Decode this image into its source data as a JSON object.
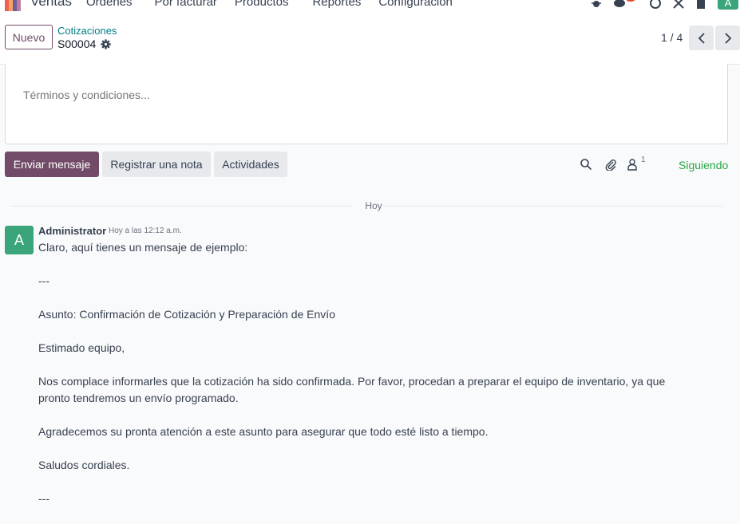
{
  "navbar": {
    "app_name": "Ventas",
    "menu": [
      "Órdenes",
      "Por facturar",
      "Productos",
      "Reportes",
      "Configuración"
    ],
    "user_initial": "A",
    "brand_colors": [
      "#f06050",
      "#f4a460",
      "#6e5e9e",
      "#c27ba0"
    ]
  },
  "control_panel": {
    "new_button": "Nuevo",
    "breadcrumb": "Cotizaciones",
    "record_name": "S00004",
    "pager": "1 / 4"
  },
  "form": {
    "terms_placeholder": "Términos y condiciones..."
  },
  "chatter": {
    "send_message": "Enviar mensaje",
    "log_note": "Registrar una nota",
    "activities": "Actividades",
    "followers_count": "1",
    "following": "Siguiendo",
    "date_separator": "Hoy",
    "message": {
      "avatar_initial": "A",
      "author": "Administrator",
      "date": "Hoy a las 12:12 a.m.",
      "paragraphs": [
        "Claro, aquí tienes un mensaje de ejemplo:",
        "---",
        "Asunto: Confirmación de Cotización y Preparación de Envío",
        "Estimado equipo,",
        "Nos complace informarles que la cotización ha sido confirmada. Por favor, procedan a preparar el equipo de inventario, ya que pronto tendremos un envío programado.",
        "Agradecemos su pronta atención a este asunto para asegurar que todo esté listo a tiempo.",
        "Saludos cordiales.",
        "---"
      ]
    }
  },
  "colors": {
    "primary": "#714b67",
    "link": "#017e84",
    "success": "#28a745",
    "avatar": "#3aa57a"
  }
}
